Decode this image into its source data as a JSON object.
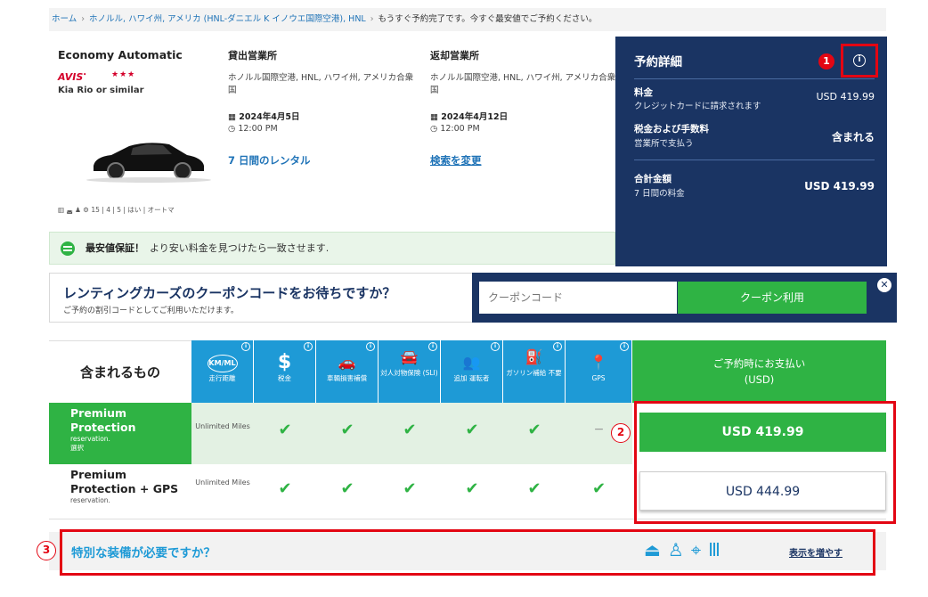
{
  "breadcrumb": {
    "home": "ホーム",
    "location": "ホノルル, ハワイ州, アメリカ (HNL-ダニエル K イノウエ国際空港), HNL",
    "current": "もうすぐ予約完了です。今すぐ最安値でご予約ください。"
  },
  "vehicle": {
    "class": "Economy Automatic",
    "vendor": "AVIS",
    "stars": "★★★",
    "model": "Kia Rio or similar",
    "specs": "15 | 4 | 5 | はい | オートマ"
  },
  "pickup": {
    "title": "貸出営業所",
    "location": "ホノルル国際空港, HNL, ハワイ州, アメリカ合衆国",
    "date": "2024年4月5日",
    "time": "12:00 PM",
    "duration": "7 日間のレンタル"
  },
  "return": {
    "title": "返却営業所",
    "location": "ホノルル国際空港, HNL, ハワイ州, アメリカ合衆国",
    "date": "2024年4月12日",
    "time": "12:00 PM",
    "change_search": "検索を変更"
  },
  "guarantee": {
    "bold": "最安値保証！",
    "text": "より安い料金を見つけたら一致させます."
  },
  "details": {
    "title": "予約詳細",
    "marker": "1",
    "info_icon": "i",
    "fee_label": "料金",
    "fee_sub": "クレジットカードに請求されます",
    "fee_value": "USD 419.99",
    "tax_label": "税金および手数料",
    "tax_sub": "営業所で支払う",
    "tax_value": "含まれる",
    "total_label": "合計金額",
    "total_sub": "7 日間の料金",
    "total_value": "USD 419.99"
  },
  "coupon": {
    "title": "レンティングカーズのクーポンコードをお待ちですか？",
    "subtitle": "ご予約の割引コードとしてご利用いただけます。",
    "placeholder": "クーポンコード",
    "button": "クーポン利用",
    "close": "✕"
  },
  "coverage": {
    "included_label": "含まれるもの",
    "features": [
      {
        "glyph": "KM/ML",
        "label": "走行距離"
      },
      {
        "glyph": "$",
        "label": "税金"
      },
      {
        "glyph": "🚗",
        "label": "車輌損害補償"
      },
      {
        "glyph": "🚘",
        "label": "対人対物保険 (SLI)"
      },
      {
        "glyph": "👥",
        "label": "追加 運転者"
      },
      {
        "glyph": "⛽",
        "label": "ガソリン補給 不要"
      },
      {
        "glyph": "📍",
        "label": "GPS"
      }
    ],
    "pay_header_line1": "ご予約時にお支払い",
    "pay_header_line2": "(USD)",
    "rows": [
      {
        "name": "Premium Protection",
        "sub1": "reservation.",
        "sub2": "選択",
        "mileage": "Unlimited Miles",
        "check": "✔",
        "gps": "−",
        "price": "USD 419.99"
      },
      {
        "name": "Premium Protection + GPS",
        "sub1": "reservation.",
        "mileage": "Unlimited Miles",
        "check": "✔",
        "gps": "✔",
        "price": "USD 444.99"
      }
    ]
  },
  "annotations": {
    "marker2": "2",
    "marker3": "3"
  },
  "equipment": {
    "title": "特別な装備が必要ですか？",
    "show_more": "表示を増やす"
  },
  "colors": {
    "navy": "#1a3463",
    "green": "#2fb344",
    "blue": "#1e9ad6",
    "annotation_red": "#e30613"
  }
}
